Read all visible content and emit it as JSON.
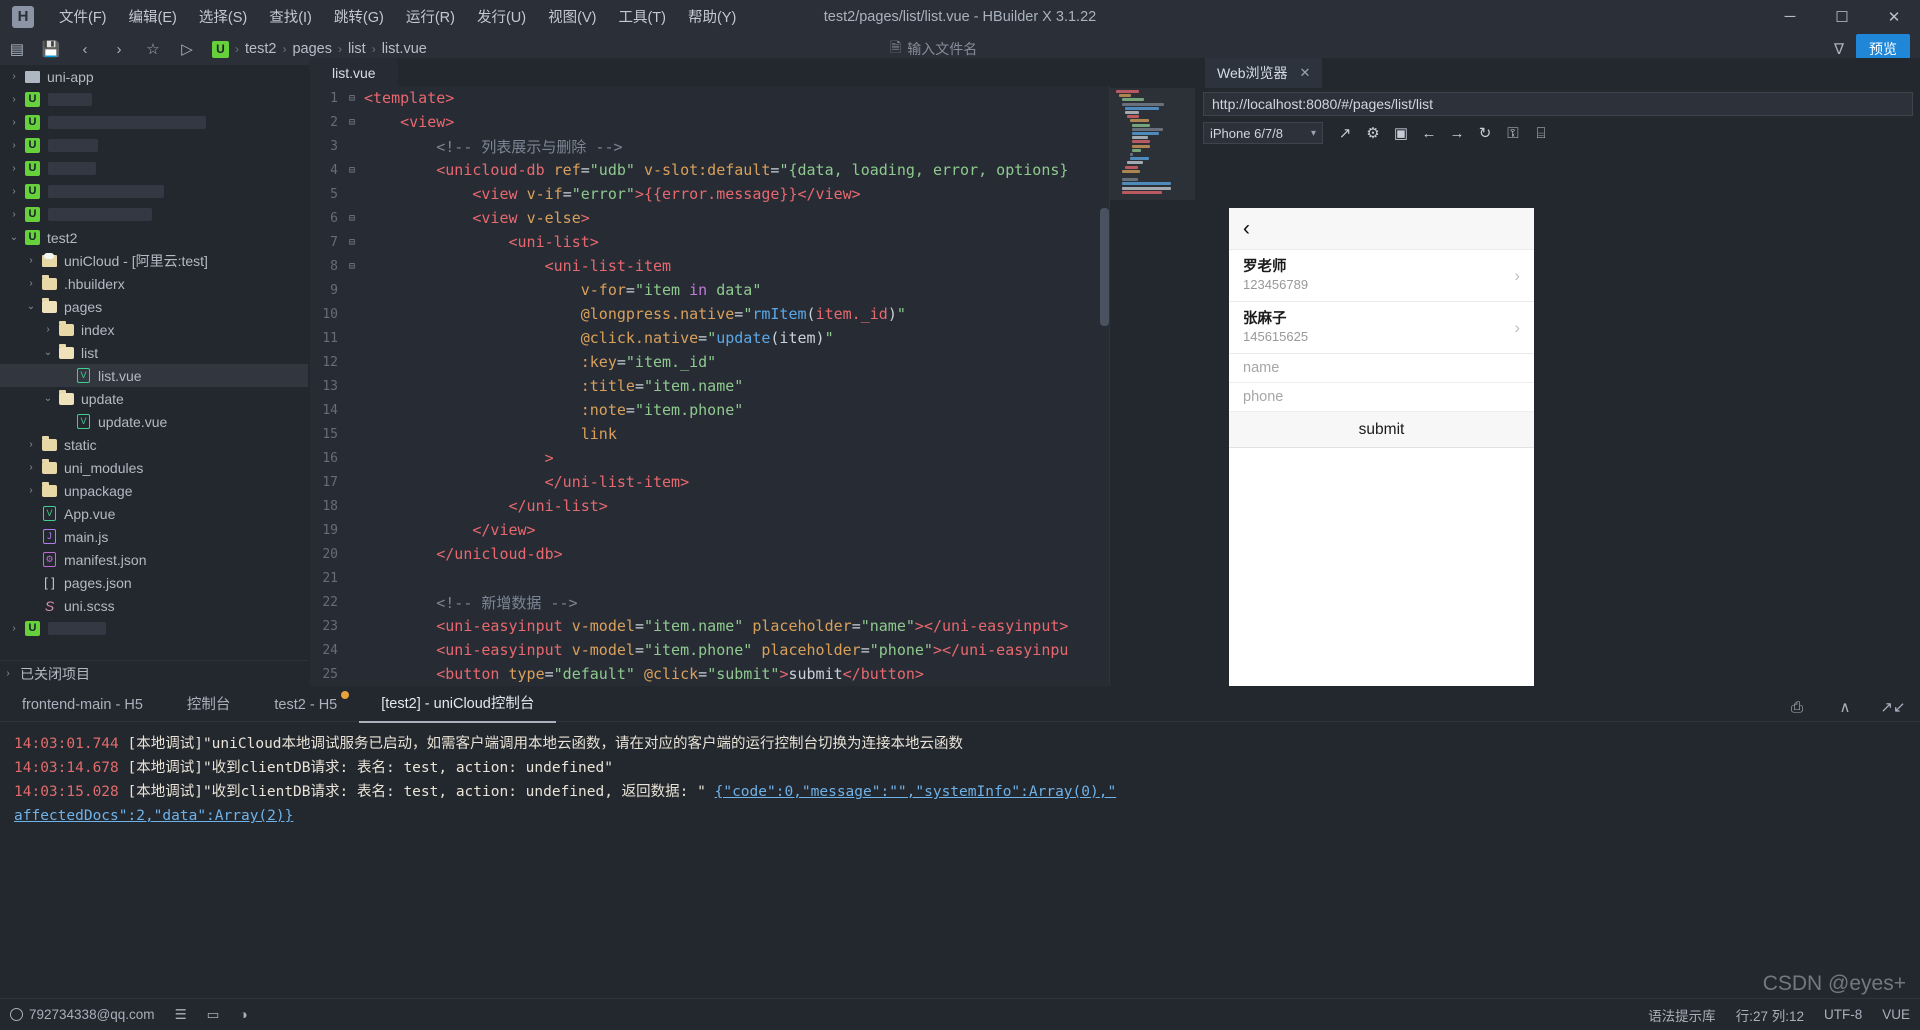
{
  "window": {
    "title": "test2/pages/list/list.vue - HBuilder X 3.1.22",
    "logo": "H",
    "minimize": "─",
    "maximize": "☐",
    "close": "✕"
  },
  "menubar": {
    "items": [
      "文件(F)",
      "编辑(E)",
      "选择(S)",
      "查找(I)",
      "跳转(G)",
      "运行(R)",
      "发行(U)",
      "视图(V)",
      "工具(T)",
      "帮助(Y)"
    ]
  },
  "toolbar": {
    "icons": [
      "panel-toggle-icon",
      "save-icon",
      "back-arrow-icon",
      "forward-arrow-icon",
      "star-icon",
      "run-icon"
    ],
    "glyphs": [
      "▤",
      "ὋE",
      "‹",
      "›",
      "☆",
      "▷"
    ],
    "breadcrumb": {
      "badge": "U",
      "segments": [
        "test2",
        "pages",
        "list",
        "list.vue"
      ],
      "separator": "›"
    },
    "file_search_placeholder": "输入文件名",
    "file_search_icon": "὜E",
    "filter_icon": "∇",
    "preview_label": "预览"
  },
  "sidebar": {
    "tree": [
      {
        "indent": 0,
        "arrow": "›",
        "icon": "uniapp",
        "label": "uni-app",
        "redacted": false,
        "selected": false
      },
      {
        "indent": 0,
        "arrow": "›",
        "icon": "badge-u",
        "label": "",
        "redacted": true,
        "redact_width": 44,
        "selected": false
      },
      {
        "indent": 0,
        "arrow": "›",
        "icon": "badge-u",
        "label": "",
        "redacted": true,
        "redact_width": 158,
        "selected": false
      },
      {
        "indent": 0,
        "arrow": "›",
        "icon": "badge-u",
        "label": "",
        "redacted": true,
        "redact_width": 50,
        "selected": false
      },
      {
        "indent": 0,
        "arrow": "›",
        "icon": "badge-u",
        "label": "",
        "redacted": true,
        "redact_width": 48,
        "selected": false
      },
      {
        "indent": 0,
        "arrow": "›",
        "icon": "badge-u",
        "label": "",
        "redacted": true,
        "redact_width": 116,
        "selected": false
      },
      {
        "indent": 0,
        "arrow": "›",
        "icon": "badge-u",
        "label": "",
        "redacted": true,
        "redact_width": 104,
        "selected": false
      },
      {
        "indent": 0,
        "arrow": "⌄",
        "icon": "badge-u",
        "label": "test2",
        "redacted": false,
        "selected": false
      },
      {
        "indent": 1,
        "arrow": "›",
        "icon": "cloud-folder",
        "label": "uniCloud - [阿里云:test]",
        "redacted": false,
        "selected": false
      },
      {
        "indent": 1,
        "arrow": "›",
        "icon": "folder",
        "label": ".hbuilderx",
        "redacted": false,
        "selected": false
      },
      {
        "indent": 1,
        "arrow": "⌄",
        "icon": "folder-open",
        "label": "pages",
        "redacted": false,
        "selected": false
      },
      {
        "indent": 2,
        "arrow": "›",
        "icon": "folder",
        "label": "index",
        "redacted": false,
        "selected": false
      },
      {
        "indent": 2,
        "arrow": "⌄",
        "icon": "folder-open",
        "label": "list",
        "redacted": false,
        "selected": false
      },
      {
        "indent": 3,
        "arrow": "",
        "icon": "vue-file",
        "label": "list.vue",
        "redacted": false,
        "selected": true
      },
      {
        "indent": 2,
        "arrow": "⌄",
        "icon": "folder-open",
        "label": "update",
        "redacted": false,
        "selected": false
      },
      {
        "indent": 3,
        "arrow": "",
        "icon": "vue-file",
        "label": "update.vue",
        "redacted": false,
        "selected": false
      },
      {
        "indent": 1,
        "arrow": "›",
        "icon": "folder",
        "label": "static",
        "redacted": false,
        "selected": false
      },
      {
        "indent": 1,
        "arrow": "›",
        "icon": "folder",
        "label": "uni_modules",
        "redacted": false,
        "selected": false
      },
      {
        "indent": 1,
        "arrow": "›",
        "icon": "folder",
        "label": "unpackage",
        "redacted": false,
        "selected": false
      },
      {
        "indent": 1,
        "arrow": "",
        "icon": "vue-file",
        "label": "App.vue",
        "redacted": false,
        "selected": false
      },
      {
        "indent": 1,
        "arrow": "",
        "icon": "js-file",
        "label": "main.js",
        "redacted": false,
        "selected": false
      },
      {
        "indent": 1,
        "arrow": "",
        "icon": "manifest-file",
        "label": "manifest.json",
        "redacted": false,
        "selected": false
      },
      {
        "indent": 1,
        "arrow": "",
        "icon": "brackets-file",
        "label": "pages.json",
        "redacted": false,
        "selected": false
      },
      {
        "indent": 1,
        "arrow": "",
        "icon": "scss-file",
        "label": "uni.scss",
        "redacted": false,
        "selected": false
      },
      {
        "indent": 0,
        "arrow": "›",
        "icon": "badge-u",
        "label": "",
        "redacted": true,
        "redact_width": 58,
        "selected": false
      }
    ],
    "closed_projects": "已关闭项目",
    "closed_projects_arrow": "›"
  },
  "editor": {
    "tab_label": "list.vue",
    "lines": [
      {
        "n": 1,
        "fold": "⊟",
        "tokens": [
          {
            "t": "tag",
            "v": "<template>"
          }
        ]
      },
      {
        "n": 2,
        "fold": "⊟",
        "tokens": [
          {
            "t": "pl",
            "v": "    "
          },
          {
            "t": "tag",
            "v": "<view>"
          }
        ]
      },
      {
        "n": 3,
        "fold": "",
        "tokens": [
          {
            "t": "pl",
            "v": "        "
          },
          {
            "t": "cmt",
            "v": "<!-- 列表展示与删除 -->"
          }
        ]
      },
      {
        "n": 4,
        "fold": "⊟",
        "tokens": [
          {
            "t": "pl",
            "v": "        "
          },
          {
            "t": "tag",
            "v": "<unicloud-db "
          },
          {
            "t": "attr",
            "v": "ref"
          },
          {
            "t": "pl",
            "v": "="
          },
          {
            "t": "str",
            "v": "\"udb\""
          },
          {
            "t": "pl",
            "v": " "
          },
          {
            "t": "attr",
            "v": "v-slot:default"
          },
          {
            "t": "pl",
            "v": "="
          },
          {
            "t": "str",
            "v": "\"{data, loading, error, options}"
          }
        ]
      },
      {
        "n": 5,
        "fold": "",
        "tokens": [
          {
            "t": "pl",
            "v": "            "
          },
          {
            "t": "tag",
            "v": "<view "
          },
          {
            "t": "attr",
            "v": "v-if"
          },
          {
            "t": "pl",
            "v": "="
          },
          {
            "t": "str",
            "v": "\"error\""
          },
          {
            "t": "tag",
            "v": ">"
          },
          {
            "t": "mustache",
            "v": "{{error.message}}"
          },
          {
            "t": "tag",
            "v": "</view>"
          }
        ]
      },
      {
        "n": 6,
        "fold": "⊟",
        "tokens": [
          {
            "t": "pl",
            "v": "            "
          },
          {
            "t": "tag",
            "v": "<view "
          },
          {
            "t": "attr",
            "v": "v-else"
          },
          {
            "t": "tag",
            "v": ">"
          }
        ]
      },
      {
        "n": 7,
        "fold": "⊟",
        "tokens": [
          {
            "t": "pl",
            "v": "                "
          },
          {
            "t": "tag",
            "v": "<uni-list>"
          }
        ]
      },
      {
        "n": 8,
        "fold": "⊟",
        "tokens": [
          {
            "t": "pl",
            "v": "                    "
          },
          {
            "t": "tag",
            "v": "<uni-list-item"
          }
        ]
      },
      {
        "n": 9,
        "fold": "",
        "tokens": [
          {
            "t": "pl",
            "v": "                        "
          },
          {
            "t": "attr",
            "v": "v-for"
          },
          {
            "t": "pl",
            "v": "="
          },
          {
            "t": "str",
            "v": "\"item "
          },
          {
            "t": "kw",
            "v": "in"
          },
          {
            "t": "str",
            "v": " data\""
          }
        ]
      },
      {
        "n": 10,
        "fold": "",
        "tokens": [
          {
            "t": "pl",
            "v": "                        "
          },
          {
            "t": "attr",
            "v": "@longpress.native"
          },
          {
            "t": "pl",
            "v": "="
          },
          {
            "t": "str",
            "v": "\""
          },
          {
            "t": "fn",
            "v": "rmItem"
          },
          {
            "t": "pl",
            "v": "("
          },
          {
            "t": "mustache",
            "v": "item._id"
          },
          {
            "t": "pl",
            "v": ")"
          },
          {
            "t": "str",
            "v": "\""
          }
        ]
      },
      {
        "n": 11,
        "fold": "",
        "tokens": [
          {
            "t": "pl",
            "v": "                        "
          },
          {
            "t": "attr",
            "v": "@click.native"
          },
          {
            "t": "pl",
            "v": "="
          },
          {
            "t": "str",
            "v": "\""
          },
          {
            "t": "fn",
            "v": "update"
          },
          {
            "t": "pl",
            "v": "(item)"
          },
          {
            "t": "str",
            "v": "\""
          }
        ]
      },
      {
        "n": 12,
        "fold": "",
        "tokens": [
          {
            "t": "pl",
            "v": "                        "
          },
          {
            "t": "attr",
            "v": ":key"
          },
          {
            "t": "pl",
            "v": "="
          },
          {
            "t": "str",
            "v": "\"item._id\""
          }
        ]
      },
      {
        "n": 13,
        "fold": "",
        "tokens": [
          {
            "t": "pl",
            "v": "                        "
          },
          {
            "t": "attr",
            "v": ":title"
          },
          {
            "t": "pl",
            "v": "="
          },
          {
            "t": "str",
            "v": "\"item.name\""
          }
        ]
      },
      {
        "n": 14,
        "fold": "",
        "tokens": [
          {
            "t": "pl",
            "v": "                        "
          },
          {
            "t": "attr",
            "v": ":note"
          },
          {
            "t": "pl",
            "v": "="
          },
          {
            "t": "str",
            "v": "\"item.phone\""
          }
        ]
      },
      {
        "n": 15,
        "fold": "",
        "tokens": [
          {
            "t": "pl",
            "v": "                        "
          },
          {
            "t": "attr",
            "v": "link"
          }
        ]
      },
      {
        "n": 16,
        "fold": "",
        "tokens": [
          {
            "t": "pl",
            "v": "                    "
          },
          {
            "t": "tag",
            "v": ">"
          }
        ]
      },
      {
        "n": 17,
        "fold": "",
        "tokens": [
          {
            "t": "pl",
            "v": "                    "
          },
          {
            "t": "tag",
            "v": "</uni-list-item>"
          }
        ]
      },
      {
        "n": 18,
        "fold": "",
        "tokens": [
          {
            "t": "pl",
            "v": "                "
          },
          {
            "t": "tag",
            "v": "</uni-list>"
          }
        ]
      },
      {
        "n": 19,
        "fold": "",
        "tokens": [
          {
            "t": "pl",
            "v": "            "
          },
          {
            "t": "tag",
            "v": "</view>"
          }
        ]
      },
      {
        "n": 20,
        "fold": "",
        "tokens": [
          {
            "t": "pl",
            "v": "        "
          },
          {
            "t": "tag",
            "v": "</unicloud-db>"
          }
        ]
      },
      {
        "n": 21,
        "fold": "",
        "tokens": [
          {
            "t": "pl",
            "v": ""
          }
        ]
      },
      {
        "n": 22,
        "fold": "",
        "tokens": [
          {
            "t": "pl",
            "v": "        "
          },
          {
            "t": "cmt",
            "v": "<!-- 新增数据 -->"
          }
        ]
      },
      {
        "n": 23,
        "fold": "",
        "tokens": [
          {
            "t": "pl",
            "v": "        "
          },
          {
            "t": "tag",
            "v": "<uni-easyinput "
          },
          {
            "t": "attr",
            "v": "v-model"
          },
          {
            "t": "pl",
            "v": "="
          },
          {
            "t": "str",
            "v": "\"item.name\""
          },
          {
            "t": "pl",
            "v": " "
          },
          {
            "t": "attr",
            "v": "placeholder"
          },
          {
            "t": "pl",
            "v": "="
          },
          {
            "t": "str",
            "v": "\"name\""
          },
          {
            "t": "tag",
            "v": "></uni-easyinput>"
          }
        ]
      },
      {
        "n": 24,
        "fold": "",
        "tokens": [
          {
            "t": "pl",
            "v": "        "
          },
          {
            "t": "tag",
            "v": "<uni-easyinput "
          },
          {
            "t": "attr",
            "v": "v-model"
          },
          {
            "t": "pl",
            "v": "="
          },
          {
            "t": "str",
            "v": "\"item.phone\""
          },
          {
            "t": "pl",
            "v": " "
          },
          {
            "t": "attr",
            "v": "placeholder"
          },
          {
            "t": "pl",
            "v": "="
          },
          {
            "t": "str",
            "v": "\"phone\""
          },
          {
            "t": "tag",
            "v": "></uni-easyinpu"
          }
        ]
      },
      {
        "n": 25,
        "fold": "",
        "tokens": [
          {
            "t": "pl",
            "v": "        "
          },
          {
            "t": "tag",
            "v": "<button "
          },
          {
            "t": "attr",
            "v": "type"
          },
          {
            "t": "pl",
            "v": "="
          },
          {
            "t": "str",
            "v": "\"default\""
          },
          {
            "t": "pl",
            "v": " "
          },
          {
            "t": "attr",
            "v": "@click"
          },
          {
            "t": "pl",
            "v": "="
          },
          {
            "t": "str",
            "v": "\"submit\""
          },
          {
            "t": "tag",
            "v": ">"
          },
          {
            "t": "pl",
            "v": "submit"
          },
          {
            "t": "tag",
            "v": "</button>"
          }
        ]
      }
    ]
  },
  "browser": {
    "tab_label": "Web浏览器",
    "tab_close": "✕",
    "url": "http://localhost:8080/#/pages/list/list",
    "device": "iPhone 6/7/8",
    "device_caret": "▾",
    "toolbar_icons": [
      "open-external-icon",
      "settings-gear-icon",
      "console-icon",
      "back-arrow-icon",
      "forward-arrow-icon",
      "reload-icon",
      "lock-icon",
      "qrcode-icon"
    ],
    "toolbar_glyphs": [
      "↗",
      "⚙",
      "▣",
      "←",
      "→",
      "↻",
      "⚿",
      "⌸"
    ],
    "preview": {
      "back_chevron": "‹",
      "list": [
        {
          "name": "罗老师",
          "phone": "123456789",
          "arrow": "›"
        },
        {
          "name": "张麻子",
          "phone": "145615625",
          "arrow": "›"
        }
      ],
      "inputs": [
        {
          "placeholder": "name"
        },
        {
          "placeholder": "phone"
        }
      ],
      "submit_label": "submit"
    }
  },
  "console": {
    "tabs": [
      {
        "label": "frontend-main - H5",
        "active": false,
        "dot": false
      },
      {
        "label": "控制台",
        "active": false,
        "dot": false
      },
      {
        "label": "test2 - H5",
        "active": false,
        "dot": true
      },
      {
        "label": "[test2] - uniCloud控制台",
        "active": true,
        "dot": false
      }
    ],
    "tools": [
      "export-icon",
      "collapse-icon",
      "clear-icon"
    ],
    "tool_glyphs": [
      "⎙",
      "∧",
      "✗"
    ],
    "lines": [
      {
        "ts": "14:03:01.744",
        "text": " [本地调试]\"uniCloud本地调试服务已启动，如需客户端调用本地云函数，请在对应的客户端的运行控制台切换为连接本地云函数",
        "link": ""
      },
      {
        "ts": "14:03:14.678",
        "text": " [本地调试]\"收到clientDB请求: 表名: test, action: undefined\"",
        "link": ""
      },
      {
        "ts": "14:03:15.028",
        "text": " [本地调试]\"收到clientDB请求: 表名: test, action: undefined, 返回数据: \" ",
        "link": "{\"code\":0,\"message\":\"\",\"systemInfo\":Array(0),\""
      },
      {
        "ts": "",
        "text": "",
        "link": "affectedDocs\":2,\"data\":Array(2)}"
      }
    ]
  },
  "statusbar": {
    "email": "792734338@qq.com",
    "left_icons": [
      "user-icon",
      "list-icon",
      "layout-icon",
      "palette-icon"
    ],
    "left_glyphs": [
      "☺",
      "☰",
      "▥",
      "◑"
    ],
    "right": [
      "语法提示库",
      "行:27 列:12",
      "UTF-8",
      "VUE"
    ]
  },
  "watermark": "CSDN @eyes+"
}
